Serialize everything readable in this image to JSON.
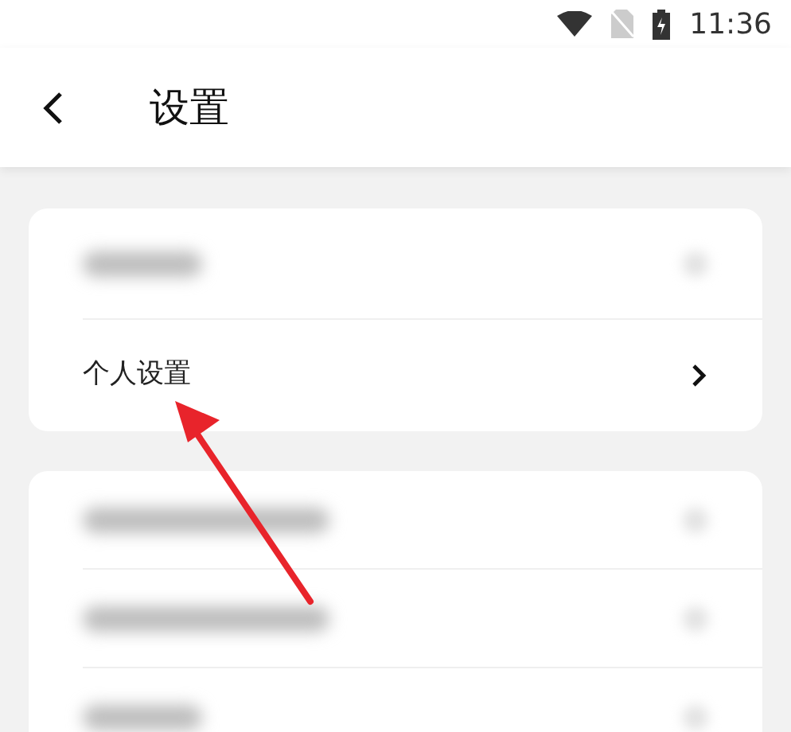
{
  "status_bar": {
    "time": "11:36"
  },
  "header": {
    "title": "设置"
  },
  "cards": [
    {
      "rows": [
        {
          "kind": "blurred",
          "long": false
        },
        {
          "kind": "text",
          "label": "个人设置"
        }
      ]
    },
    {
      "rows": [
        {
          "kind": "blurred",
          "long": true
        },
        {
          "kind": "blurred",
          "long": true
        },
        {
          "kind": "blurred",
          "long": false
        }
      ]
    }
  ],
  "annotation": {
    "kind": "arrow"
  }
}
